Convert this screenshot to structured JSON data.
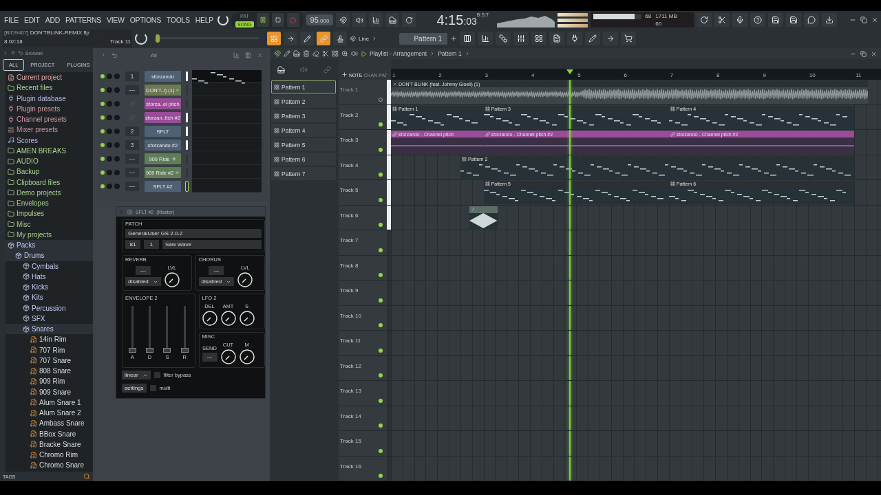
{
  "menu": [
    "FILE",
    "EDIT",
    "ADD",
    "PATTERNS",
    "VIEW",
    "OPTIONS",
    "TOOLS",
    "HELP"
  ],
  "transport": {
    "modes": [
      {
        "label": "PAT",
        "selected": false
      },
      {
        "label": "SONG",
        "selected": true
      }
    ],
    "playing": true,
    "tempo": "95",
    "tempo_fraction": ".000",
    "time_main": "4:15",
    "time_sub": ":03",
    "time_label": "B:S:T"
  },
  "monitor": {
    "level": 0.85,
    "cpu": "68",
    "memory": "1711 MB",
    "polyphony": "60"
  },
  "project": {
    "id": "[BID9467]",
    "file": "DON'TBLINK-REMIX.flp",
    "elapsed": "8:02:18",
    "hint": "Track 11"
  },
  "pitch_slider": {
    "level": 0
  },
  "tools": [
    {
      "kind": "rack",
      "active": true
    },
    {
      "kind": "arrow",
      "active": false
    },
    {
      "kind": "pencil",
      "active": false
    },
    {
      "kind": "link",
      "active": true
    },
    {
      "kind": "stamp",
      "active": false
    }
  ],
  "snap": "Line",
  "pattern": "Pattern 1",
  "browser": {
    "title": "Browser",
    "tabs": [
      {
        "label": "ALL",
        "selected": true
      },
      {
        "label": "PROJECT",
        "selected": false
      },
      {
        "label": "PLUGINS",
        "selected": false
      }
    ],
    "items": [
      {
        "kind": "project",
        "label": "Current project"
      },
      {
        "kind": "recent",
        "label": "Recent files"
      },
      {
        "kind": "plugin",
        "label": "Plugin database"
      },
      {
        "kind": "preset",
        "label": "Plugin presets"
      },
      {
        "kind": "preset",
        "label": "Channel presets"
      },
      {
        "kind": "mixer",
        "label": "Mixer presets"
      },
      {
        "kind": "score",
        "label": "Scores"
      },
      {
        "kind": "folder",
        "label": "AMEN BREAKS"
      },
      {
        "kind": "folder",
        "label": "AUDIO"
      },
      {
        "kind": "recent",
        "label": "Backup"
      },
      {
        "kind": "folder",
        "label": "Clipboard files"
      },
      {
        "kind": "folder",
        "label": "Demo projects"
      },
      {
        "kind": "folder",
        "label": "Envelopes"
      },
      {
        "kind": "folder",
        "label": "Impulses"
      },
      {
        "kind": "folder",
        "label": "Misc"
      },
      {
        "kind": "folder",
        "label": "My projects"
      },
      {
        "kind": "pack",
        "label": "Packs",
        "expanded": true,
        "children": [
          {
            "kind": "pack",
            "label": "Drums",
            "expanded": true,
            "children": [
              {
                "kind": "pack",
                "label": "Cymbals",
                "expanded": false
              },
              {
                "kind": "pack",
                "label": "Hats",
                "expanded": false
              },
              {
                "kind": "pack",
                "label": "Kicks",
                "expanded": false
              },
              {
                "kind": "pack",
                "label": "Kits",
                "expanded": false
              },
              {
                "kind": "pack",
                "label": "Percussion",
                "expanded": false
              },
              {
                "kind": "pack",
                "label": "SFX",
                "expanded": false
              },
              {
                "kind": "pack",
                "label": "Snares",
                "expanded": true,
                "children": [
                  {
                    "kind": "sample",
                    "label": "14in Rim"
                  },
                  {
                    "kind": "sample",
                    "label": "707 Rim"
                  },
                  {
                    "kind": "sample",
                    "label": "707 Snare"
                  },
                  {
                    "kind": "sample",
                    "label": "808 Snare"
                  },
                  {
                    "kind": "sample",
                    "label": "909 Rim"
                  },
                  {
                    "kind": "sample",
                    "label": "909 Snare"
                  },
                  {
                    "kind": "sample",
                    "label": "Alum Snare 1"
                  },
                  {
                    "kind": "sample",
                    "label": "Alum Snare 2"
                  },
                  {
                    "kind": "sample",
                    "label": "Ambass Snare"
                  },
                  {
                    "kind": "sample",
                    "label": "BBox Snare"
                  },
                  {
                    "kind": "sample",
                    "label": "Bracke Snare"
                  },
                  {
                    "kind": "sample",
                    "label": "Chromo Rim"
                  },
                  {
                    "kind": "sample",
                    "label": "Chromo Snare"
                  }
                ]
              }
            ]
          }
        ]
      }
    ],
    "tags": "TAGS"
  },
  "channel_rack": {
    "filter": "All",
    "channels": [
      {
        "kind": "instrument",
        "name": "sforzando",
        "mixer": "1",
        "color": "#4f6175",
        "on": true,
        "selected": true,
        "current": false
      },
      {
        "kind": "sampler",
        "name": "DON'T..i) (1)",
        "mixer": "---",
        "color": "#6b7a52",
        "on": true,
        "selected": false,
        "current": false
      },
      {
        "kind": "automation",
        "name": "sforza..el pitch",
        "color": "#9a4c98",
        "on": true,
        "selected": false,
        "current": false
      },
      {
        "kind": "automation",
        "name": "sforzan..itch #2",
        "color": "#9a4c98",
        "on": true,
        "selected": true,
        "current": false
      },
      {
        "kind": "instrument",
        "name": "SFLT",
        "mixer": "2",
        "color": "#4f6175",
        "on": true,
        "selected": true,
        "current": false
      },
      {
        "kind": "instrument",
        "name": "sforzando #2",
        "mixer": "3",
        "color": "#4f6175",
        "on": true,
        "selected": true,
        "current": false
      },
      {
        "kind": "sampler",
        "name": "909 Ride",
        "mixer": "---",
        "color": "#5f7d58",
        "on": true,
        "selected": false,
        "current": false
      },
      {
        "kind": "sampler",
        "name": "909 Ride #2",
        "mixer": "---",
        "color": "#5f7d58",
        "on": true,
        "selected": false,
        "current": false
      },
      {
        "kind": "instrument",
        "name": "SFLT #2",
        "mixer": "---",
        "color": "#4f6175",
        "on": true,
        "selected": false,
        "current": true
      }
    ]
  },
  "plugin": {
    "title": "SFLT #2",
    "route": "(Master)",
    "patch_label": "PATCH",
    "soundfont": "GeneralUser GS 2.0.2",
    "bank": "81",
    "program": "1",
    "preset": "Saw Wave",
    "reverb": {
      "label": "REVERB",
      "value": "---",
      "mode": "disabled",
      "knob": "LVL"
    },
    "chorus": {
      "label": "CHORUS",
      "value": "---",
      "mode": "disabled",
      "knob": "LVL"
    },
    "envelope": {
      "label": "ENVELOPE 2",
      "sliders": [
        {
          "label": "A",
          "level": 0
        },
        {
          "label": "D",
          "level": 0
        },
        {
          "label": "S",
          "level": 0
        },
        {
          "label": "R",
          "level": 0
        }
      ]
    },
    "lfo": {
      "label": "LFO 2",
      "knobs": [
        "DEL",
        "AMT",
        "S"
      ]
    },
    "misc": {
      "label": "MISC",
      "send_label": "SEND",
      "send_value": "---",
      "knobs": [
        "CUT",
        "M"
      ]
    },
    "curve": "linear",
    "filter_bypass": {
      "label": "filter bypass",
      "checked": false
    },
    "settings": "settings",
    "multi": {
      "label": "multi",
      "checked": false
    }
  },
  "patterns": [
    {
      "label": "Pattern 1",
      "selected": true
    },
    {
      "label": "Pattern 2",
      "selected": false
    },
    {
      "label": "Pattern 3",
      "selected": false
    },
    {
      "label": "Pattern 4",
      "selected": false
    },
    {
      "label": "Pattern 5",
      "selected": false
    },
    {
      "label": "Pattern 6",
      "selected": false
    },
    {
      "label": "Pattern 7",
      "selected": false
    }
  ],
  "playlist": {
    "title": "Playlist - Arrangement",
    "crumb": "Pattern 1",
    "modes": [
      "NOTE",
      "CHAN",
      "PAT"
    ],
    "ruler": [
      "1",
      "2",
      "3",
      "4",
      "5",
      "6",
      "7",
      "8",
      "9",
      "10",
      "11"
    ],
    "tracks": [
      {
        "name": "Track 1",
        "on": false,
        "clips": [
          {
            "kind": "audio",
            "name": "DON'T BLINK (feat. Johnny Gioeli) (1)"
          }
        ]
      },
      {
        "name": "Track 2",
        "on": true,
        "clips": [
          {
            "kind": "pattern",
            "name": "Pattern 1"
          },
          {
            "kind": "pattern",
            "name": "Pattern 3"
          },
          {
            "kind": "pattern",
            "name": "Pattern 4"
          }
        ]
      },
      {
        "name": "Track 3",
        "on": true,
        "clips": [
          {
            "kind": "automation",
            "name": "sforzando - Channel pitch"
          },
          {
            "kind": "automation",
            "name": "sforzando - Channel pitch #2"
          },
          {
            "kind": "automation",
            "name": "sforzando - Channel pitch #2"
          }
        ]
      },
      {
        "name": "Track 4",
        "on": true,
        "clips": [
          {
            "kind": "pattern",
            "name": "Pattern 2"
          }
        ]
      },
      {
        "name": "Track 5",
        "on": true,
        "clips": [
          {
            "kind": "pattern",
            "name": "Pattern 5"
          },
          {
            "kind": "pattern",
            "name": "Pattern 6"
          }
        ]
      },
      {
        "name": "Track 6",
        "on": true,
        "clips": [
          {
            "kind": "sample"
          }
        ]
      },
      {
        "name": "Track 7",
        "on": true
      },
      {
        "name": "Track 8",
        "on": true
      },
      {
        "name": "Track 9",
        "on": true
      },
      {
        "name": "Track 10",
        "on": true
      },
      {
        "name": "Track 11",
        "on": true
      },
      {
        "name": "Track 12",
        "on": true
      },
      {
        "name": "Track 13",
        "on": true
      },
      {
        "name": "Track 14",
        "on": true
      },
      {
        "name": "Track 15",
        "on": true
      },
      {
        "name": "Track 16",
        "on": true
      }
    ]
  }
}
